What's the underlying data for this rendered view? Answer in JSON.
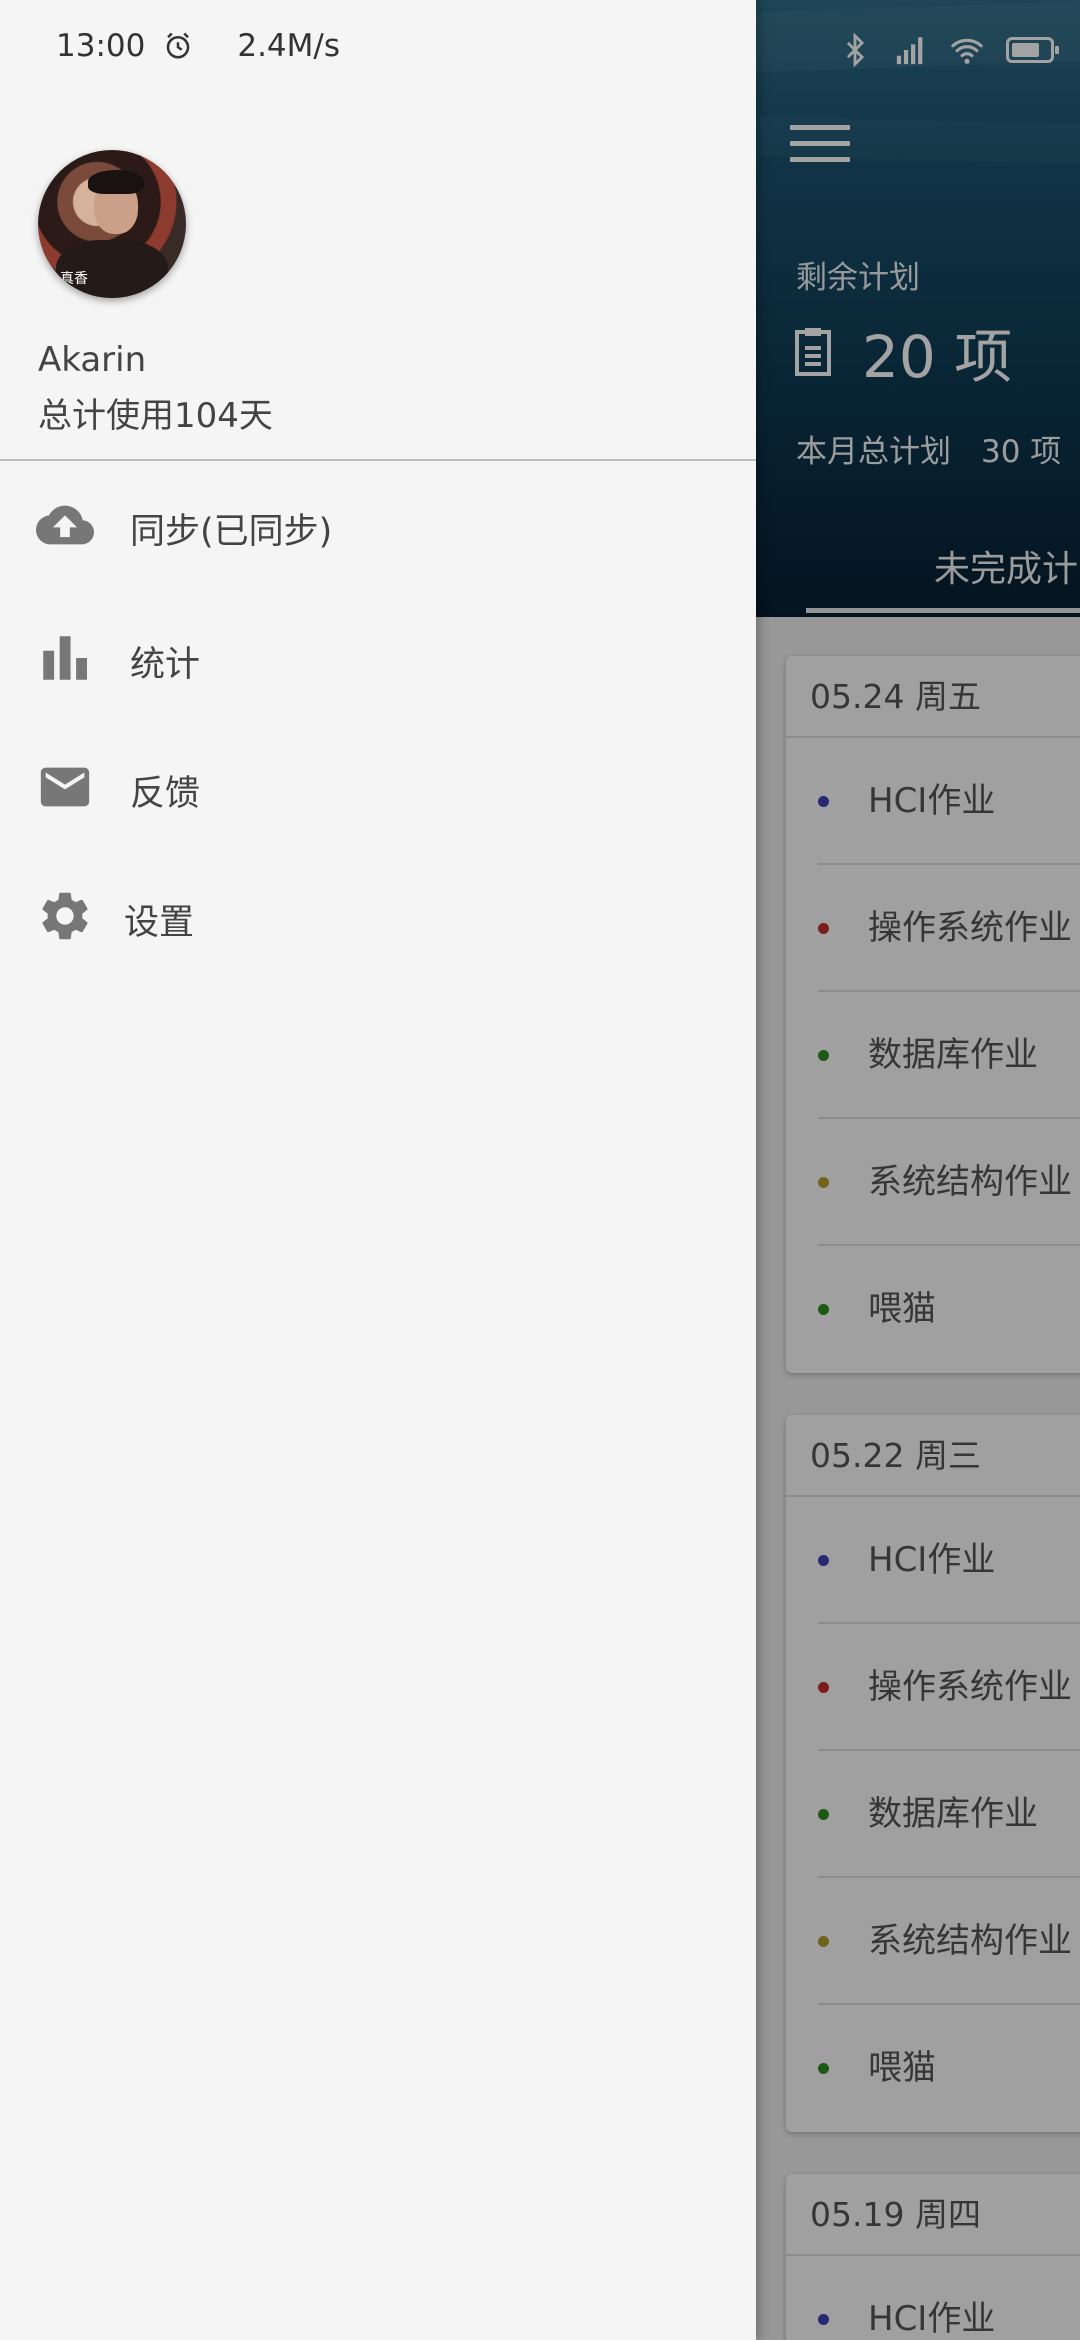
{
  "status_bar": {
    "time": "13:00",
    "net_speed": "2.4M/s",
    "icons": [
      "alarm-icon",
      "bluetooth-icon",
      "signal-icon",
      "wifi-icon",
      "battery-icon"
    ],
    "battery_level": 0.75
  },
  "drawer": {
    "avatar_caption": "真香",
    "user_name": "Akarin",
    "usage_text": "总计使用104天",
    "menu": [
      {
        "label": "同步(已同步)",
        "icon": "cloud-upload-icon"
      },
      {
        "label": "统计",
        "icon": "bar-chart-icon"
      },
      {
        "label": "反馈",
        "icon": "mail-icon"
      },
      {
        "label": "设置",
        "icon": "gear-icon"
      }
    ]
  },
  "header": {
    "remaining_label": "剩余计划",
    "remaining_count": "20 项",
    "month_label": "本月总计划",
    "month_value": "30 项",
    "tab_label": "未完成计"
  },
  "days": [
    {
      "date": "05.24 周五",
      "tasks": [
        {
          "name": "HCI作业",
          "color": "#3f3fb5"
        },
        {
          "name": "操作系统作业",
          "color": "#c0302a"
        },
        {
          "name": "数据库作业",
          "color": "#2e8a25"
        },
        {
          "name": "系统结构作业",
          "color": "#b39c2a"
        },
        {
          "name": "喂猫",
          "color": "#2e8a25"
        }
      ]
    },
    {
      "date": "05.22 周三",
      "tasks": [
        {
          "name": "HCI作业",
          "color": "#3f3fb5"
        },
        {
          "name": "操作系统作业",
          "color": "#c0302a"
        },
        {
          "name": "数据库作业",
          "color": "#2e8a25"
        },
        {
          "name": "系统结构作业",
          "color": "#b39c2a"
        },
        {
          "name": "喂猫",
          "color": "#2e8a25"
        }
      ]
    },
    {
      "date": "05.19 周四",
      "tasks": [
        {
          "name": "HCI作业",
          "color": "#3f3fb5"
        }
      ]
    }
  ],
  "colors": {
    "drawer_bg": "#f5f5f5",
    "header_dark": "#0f3c55",
    "icon_gray": "#777777",
    "text_gray": "#444444"
  }
}
